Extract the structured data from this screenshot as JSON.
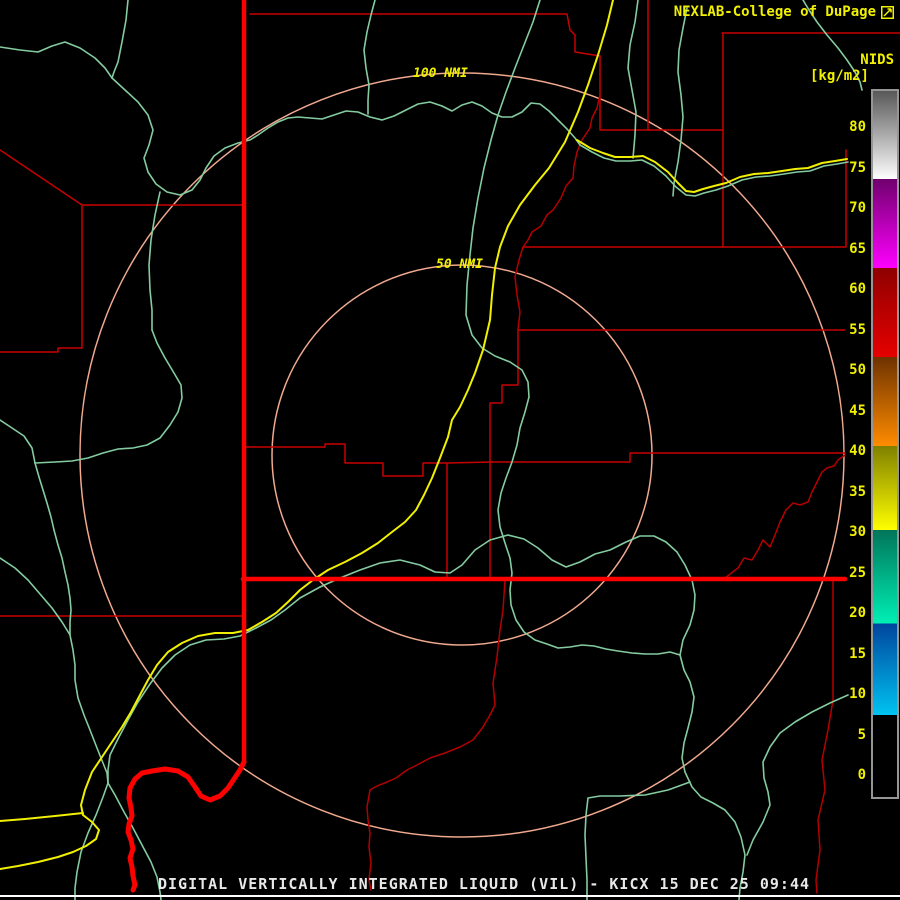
{
  "header": {
    "brand": "NEXLAB-College of DuPage",
    "product_code": "NIDS",
    "unit_label": "[kg/m2]"
  },
  "range_rings": {
    "outer_label": "100 NMI",
    "inner_label": "50 NMI"
  },
  "status_bar": {
    "text": "DIGITAL VERTICALLY INTEGRATED LIQUID (VIL) - KICX 15 DEC 25 09:44",
    "product_name": "DIGITAL VERTICALLY INTEGRATED LIQUID (VIL)",
    "station": "KICX",
    "datetime": "15 DEC 25 09:44"
  },
  "colorbar": {
    "unit": "kg/m2",
    "ticks": [
      "80",
      "75",
      "70",
      "65",
      "60",
      "55",
      "50",
      "45",
      "40",
      "35",
      "30",
      "25",
      "20",
      "15",
      "10",
      "5",
      "0"
    ],
    "segments": [
      {
        "range": "75-85",
        "color_top": "#585858",
        "color_bottom": "#FFFFFF"
      },
      {
        "range": "63-74",
        "color_top": "#70006E",
        "color_bottom": "#FF00FF"
      },
      {
        "range": "52-62",
        "color_top": "#8F0000",
        "color_bottom": "#E60000"
      },
      {
        "range": "41-51",
        "color_top": "#6E3200",
        "color_bottom": "#FF8C00"
      },
      {
        "range": "30-40",
        "color_top": "#808000",
        "color_bottom": "#FFFF00"
      },
      {
        "range": "19-29",
        "color_top": "#00755A",
        "color_bottom": "#00EFB4"
      },
      {
        "range": "8-18",
        "color_top": "#00459E",
        "color_bottom": "#00C3F0"
      },
      {
        "range": "0-7",
        "color_top": "#000000",
        "color_bottom": "#000000"
      }
    ]
  },
  "colors": {
    "background": "#000000",
    "state_border": "#FF0000",
    "county_line": "#C80000",
    "river_county_line": "#B40000",
    "highway": "#F0F000",
    "river": "#84CCA0",
    "range_ring": "#F0A98E",
    "label_yellow": "#F0F000",
    "status_text": "#E8E8E8"
  }
}
